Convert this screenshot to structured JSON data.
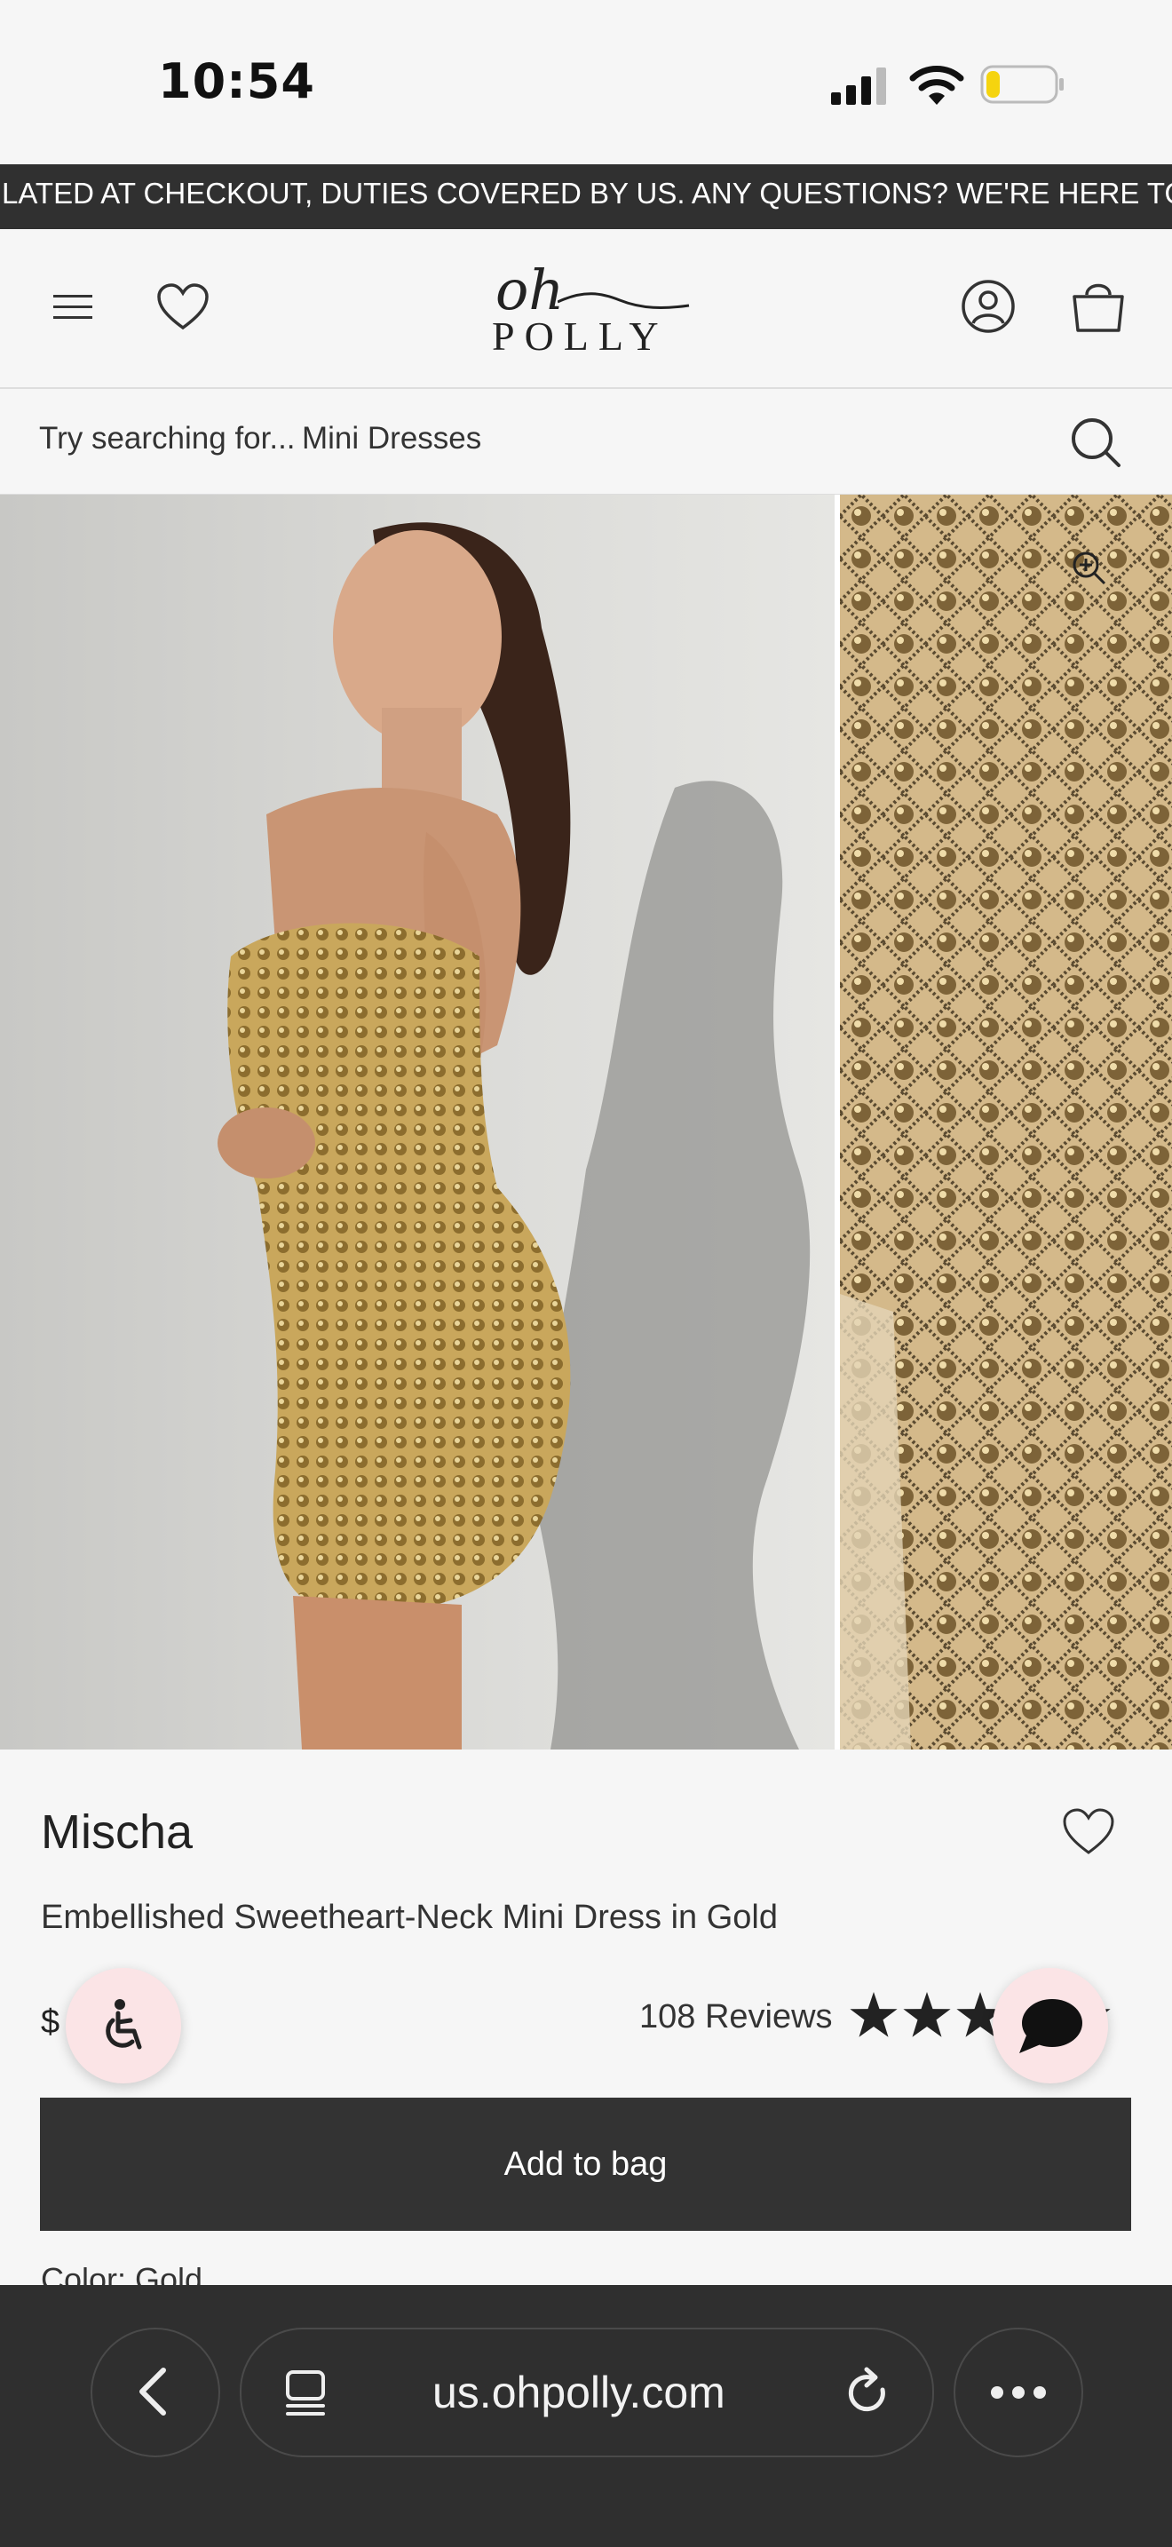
{
  "status_bar": {
    "time": "10:54",
    "battery_level": 0.2
  },
  "announcement": {
    "text": "LATED AT CHECKOUT, DUTIES COVERED BY US. ANY QUESTIONS? WE'RE HERE TO HELP."
  },
  "header": {
    "brand_oh": "oh",
    "brand_polly": "POLLY",
    "icons": [
      "menu-icon",
      "heart-icon",
      "account-icon",
      "bag-icon"
    ]
  },
  "search": {
    "prompt": "Try searching for...",
    "suggestion": "Mini Dresses"
  },
  "product": {
    "name": "Mischa",
    "subtitle": "Embellished Sweetheart-Neck Mini Dress in Gold",
    "price": "$",
    "reviews": "108 Reviews",
    "rating": 5,
    "add_to_bag": "Add to bag",
    "color_label": "Color: Gold"
  },
  "browser": {
    "url": "us.ohpolly.com"
  },
  "colors": {
    "announcement_bg": "#303030",
    "button_dark": "#333333",
    "floating_button_bg": "#fbe4e6",
    "browser_bg": "#2f2f2f",
    "page_bg": "#f6f6f6"
  }
}
